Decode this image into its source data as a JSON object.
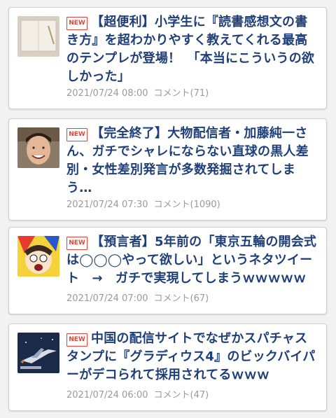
{
  "badge": "NEW",
  "articles": [
    {
      "title": "【超便利】小学生に『読書感想文の書き方』を超わかりやすく教えてくれる最高のテンプレが登場！　「本当にこういうの欲しかった」",
      "date": "2021/07/24 08:00",
      "comments": "コメント(71)",
      "thumbnail": "notebook-photo"
    },
    {
      "title": "【完全終了】大物配信者・加藤純一さん、ガチでシャレにならない直球の黒人差別・女性差別発言が多数発掘されてしまう…",
      "date": "2021/07/24 07:30",
      "comments": "コメント(1090)",
      "thumbnail": "smiling-man-photo"
    },
    {
      "title": "【預言者】5年前の「東京五輪の開会式は◯◯◯やって欲しい」というネタツイート　→　ガチで実現してしまうｗｗｗｗｗ",
      "date": "2021/07/24 07:00",
      "comments": "コメント(67)",
      "thumbnail": "anime-illustration"
    },
    {
      "title": "中国の配信サイトでなぜかスパチャスタンプに『グラディウス4』のビックバイパーがデコられて採用されてるｗｗｗ",
      "date": "2021/07/24 06:00",
      "comments": "コメント(47)",
      "thumbnail": "spaceship-game-art"
    }
  ],
  "colors": {
    "title": "#1f3f7a",
    "badge": "#e8433a",
    "meta": "#9a9a9a",
    "background": "#f2f2f2"
  }
}
